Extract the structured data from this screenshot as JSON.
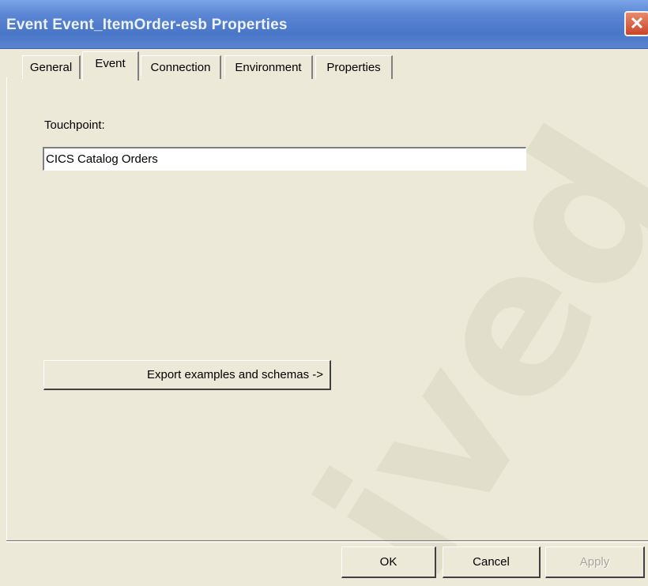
{
  "window": {
    "title": "Event Event_ItemOrder-esb Properties",
    "close_glyph": "✕"
  },
  "tabs": [
    {
      "label": "General",
      "active": false
    },
    {
      "label": "Event",
      "active": true
    },
    {
      "label": "Connection",
      "active": false
    },
    {
      "label": "Environment",
      "active": false
    },
    {
      "label": "Properties",
      "active": false
    }
  ],
  "event_tab": {
    "touchpoint_label": "Touchpoint:",
    "touchpoint_value": "CICS Catalog Orders",
    "export_button_label": "Export examples and schemas ->"
  },
  "buttons": {
    "ok_label": "OK",
    "cancel_label": "Cancel",
    "apply_label": "Apply"
  },
  "watermark": "ived",
  "colors": {
    "titlebar": "#4a76c8",
    "dialog_bg": "#ece9d8",
    "close_button": "#c8462a"
  }
}
